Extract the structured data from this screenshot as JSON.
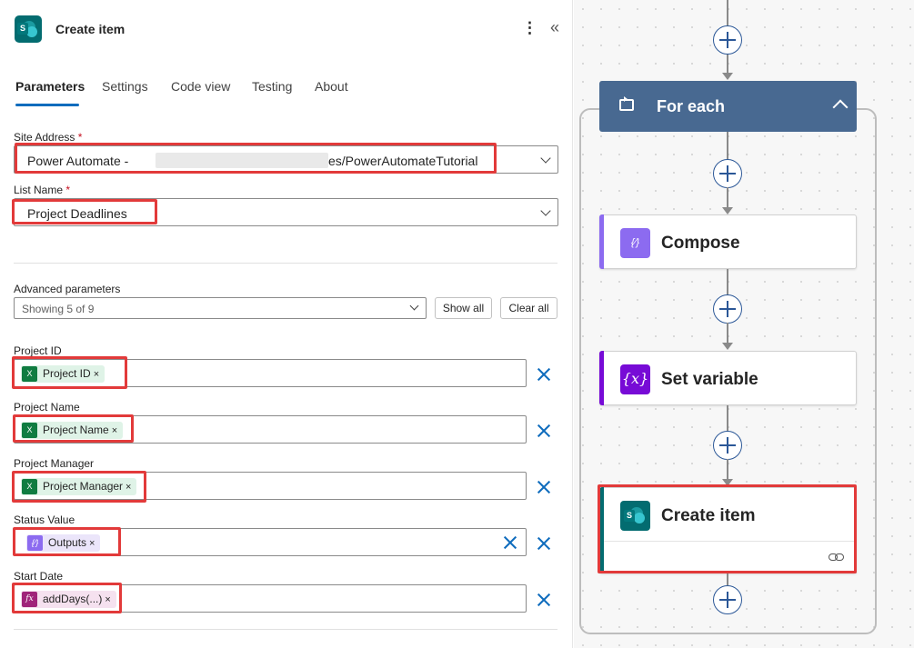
{
  "panel": {
    "title": "Create item",
    "more_glyph": "⋮",
    "collapse_glyph": "«",
    "tabs": [
      {
        "label": "Parameters",
        "active": true
      },
      {
        "label": "Settings"
      },
      {
        "label": "Code view"
      },
      {
        "label": "Testing"
      },
      {
        "label": "About"
      }
    ],
    "site_address": {
      "label": "Site Address",
      "required_mark": "*",
      "value_prefix": "Power Automate - ",
      "value_suffix": "es/PowerAutomateTutorial"
    },
    "list_name": {
      "label": "List Name",
      "required_mark": "*",
      "value": "Project Deadlines"
    },
    "advanced": {
      "label": "Advanced parameters",
      "showing": "Showing 5 of 9",
      "show_all": "Show all",
      "clear_all": "Clear all"
    },
    "fields": [
      {
        "label": "Project ID",
        "token": "Project ID",
        "token_type": "excel"
      },
      {
        "label": "Project Name",
        "token": "Project Name",
        "token_type": "excel"
      },
      {
        "label": "Project Manager",
        "token": "Project Manager",
        "token_type": "excel"
      },
      {
        "label": "Status Value",
        "token": "Outputs",
        "token_type": "variable"
      },
      {
        "label": "Start Date",
        "token": "addDays(...)",
        "token_type": "expression"
      }
    ],
    "token_remove_glyph": "×",
    "icons": {
      "excel_token": "excel-icon",
      "compose_token": "compose-icon",
      "fx_token": "fx-icon"
    }
  },
  "canvas": {
    "for_each": "For each",
    "compose": "Compose",
    "compose_icon_text": "{⁄}",
    "set_variable": "Set variable",
    "set_variable_icon_text": "{x}",
    "create_item": "Create item",
    "colors": {
      "for_each": "#486991",
      "compose": "#8c6bf0",
      "set_variable": "#770bd6",
      "sharepoint": "#036c70",
      "plus": "#2b5797",
      "highlight": "#e23a3a"
    }
  }
}
